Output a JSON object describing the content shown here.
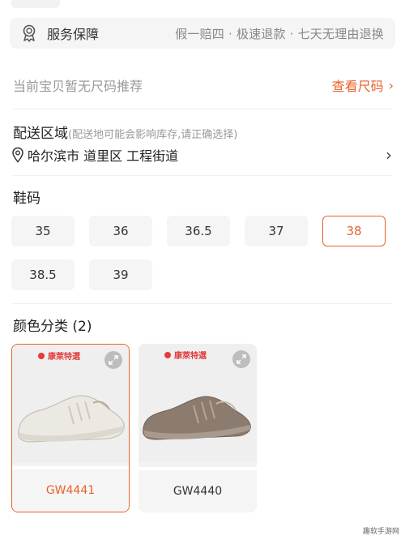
{
  "service": {
    "label": "服务保障",
    "description": "假一赔四 · 极速退款 · 七天无理由退换",
    "icon": "badge-icon"
  },
  "size_recommendation": {
    "text": "当前宝贝暂无尺码推荐",
    "link_label": "查看尺码",
    "link_icon": "chevron-right-icon"
  },
  "delivery": {
    "title": "配送区域",
    "subtitle": "(配送地可能会影响库存,请正确选择)",
    "address": "哈尔滨市 道里区 工程街道",
    "icon": "location-pin-icon"
  },
  "shoe_size": {
    "title": "鞋码",
    "options": [
      "35",
      "36",
      "36.5",
      "37",
      "38",
      "38.5",
      "39"
    ],
    "selected": "38"
  },
  "color": {
    "title": "颜色分类 (2)",
    "options": [
      {
        "name": "GW4441",
        "brand": "康萊特選",
        "selected": true,
        "color": "#ece9e2"
      },
      {
        "name": "GW4440",
        "brand": "康萊特選",
        "selected": false,
        "color": "#8c7c70"
      }
    ]
  },
  "accent_color": "#e8612c",
  "watermark": "趣软手游网"
}
